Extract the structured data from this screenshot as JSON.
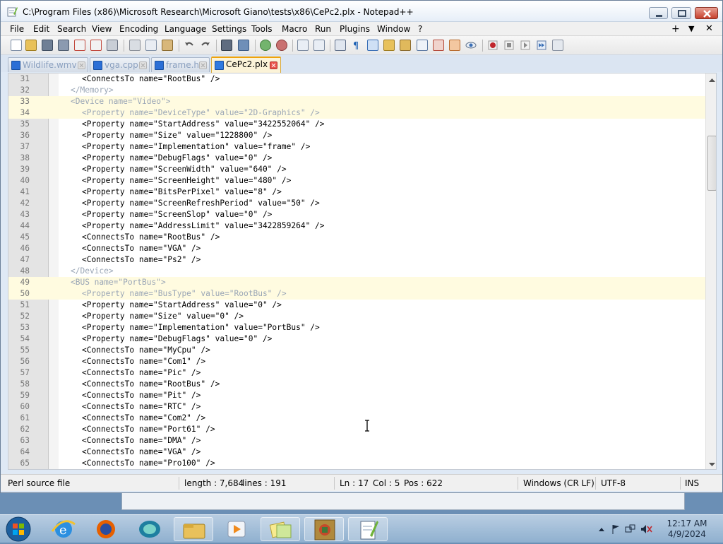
{
  "window": {
    "title": "C:\\Program Files (x86)\\Microsoft Research\\Microsoft Giano\\tests\\x86\\CePc2.plx - Notepad++"
  },
  "menubar": {
    "items": [
      "File",
      "Edit",
      "Search",
      "View",
      "Encoding",
      "Language",
      "Settings",
      "Tools",
      "Macro",
      "Run",
      "Plugins",
      "Window",
      "?"
    ],
    "right": {
      "plus": "+",
      "down": "▼",
      "close": "✕"
    }
  },
  "tabs": [
    {
      "label": "Wildlife.wmv",
      "active": false
    },
    {
      "label": "vga.cpp",
      "active": false
    },
    {
      "label": "frame.h",
      "active": false
    },
    {
      "label": "CePc2.plx",
      "active": true
    }
  ],
  "editor": {
    "lines": [
      {
        "n": "31",
        "indent": 4,
        "text": "<ConnectsTo name=\"RootBus\" />",
        "dim": false,
        "hl": false
      },
      {
        "n": "32",
        "indent": 2,
        "text": "</Memory>",
        "dim": true,
        "hl": false
      },
      {
        "n": "33",
        "indent": 2,
        "text": "<Device name=\"Video\">",
        "dim": true,
        "hl": true
      },
      {
        "n": "34",
        "indent": 4,
        "text": "<Property name=\"DeviceType\" value=\"2D-Graphics\" />",
        "dim": true,
        "hl": true
      },
      {
        "n": "35",
        "indent": 4,
        "text": "<Property name=\"StartAddress\" value=\"3422552064\" />",
        "dim": false,
        "hl": false
      },
      {
        "n": "36",
        "indent": 4,
        "text": "<Property name=\"Size\" value=\"1228800\" />",
        "dim": false,
        "hl": false
      },
      {
        "n": "37",
        "indent": 4,
        "text": "<Property name=\"Implementation\" value=\"frame\" />",
        "dim": false,
        "hl": false
      },
      {
        "n": "38",
        "indent": 4,
        "text": "<Property name=\"DebugFlags\" value=\"0\" />",
        "dim": false,
        "hl": false
      },
      {
        "n": "39",
        "indent": 4,
        "text": "<Property name=\"ScreenWidth\" value=\"640\" />",
        "dim": false,
        "hl": false
      },
      {
        "n": "40",
        "indent": 4,
        "text": "<Property name=\"ScreenHeight\" value=\"480\" />",
        "dim": false,
        "hl": false
      },
      {
        "n": "41",
        "indent": 4,
        "text": "<Property name=\"BitsPerPixel\" value=\"8\" />",
        "dim": false,
        "hl": false
      },
      {
        "n": "42",
        "indent": 4,
        "text": "<Property name=\"ScreenRefreshPeriod\" value=\"50\" />",
        "dim": false,
        "hl": false
      },
      {
        "n": "43",
        "indent": 4,
        "text": "<Property name=\"ScreenSlop\" value=\"0\" />",
        "dim": false,
        "hl": false
      },
      {
        "n": "44",
        "indent": 4,
        "text": "<Property name=\"AddressLimit\" value=\"3422859264\" />",
        "dim": false,
        "hl": false
      },
      {
        "n": "45",
        "indent": 4,
        "text": "<ConnectsTo name=\"RootBus\" />",
        "dim": false,
        "hl": false
      },
      {
        "n": "46",
        "indent": 4,
        "text": "<ConnectsTo name=\"VGA\" />",
        "dim": false,
        "hl": false
      },
      {
        "n": "47",
        "indent": 4,
        "text": "<ConnectsTo name=\"Ps2\" />",
        "dim": false,
        "hl": false
      },
      {
        "n": "48",
        "indent": 2,
        "text": "</Device>",
        "dim": true,
        "hl": false
      },
      {
        "n": "49",
        "indent": 2,
        "text": "<BUS name=\"PortBus\">",
        "dim": true,
        "hl": true
      },
      {
        "n": "50",
        "indent": 4,
        "text": "<Property name=\"BusType\" value=\"RootBus\" />",
        "dim": true,
        "hl": true
      },
      {
        "n": "51",
        "indent": 4,
        "text": "<Property name=\"StartAddress\" value=\"0\" />",
        "dim": false,
        "hl": false
      },
      {
        "n": "52",
        "indent": 4,
        "text": "<Property name=\"Size\" value=\"0\" />",
        "dim": false,
        "hl": false
      },
      {
        "n": "53",
        "indent": 4,
        "text": "<Property name=\"Implementation\" value=\"PortBus\" />",
        "dim": false,
        "hl": false
      },
      {
        "n": "54",
        "indent": 4,
        "text": "<Property name=\"DebugFlags\" value=\"0\" />",
        "dim": false,
        "hl": false
      },
      {
        "n": "55",
        "indent": 4,
        "text": "<ConnectsTo name=\"MyCpu\" />",
        "dim": false,
        "hl": false
      },
      {
        "n": "56",
        "indent": 4,
        "text": "<ConnectsTo name=\"Com1\" />",
        "dim": false,
        "hl": false
      },
      {
        "n": "57",
        "indent": 4,
        "text": "<ConnectsTo name=\"Pic\" />",
        "dim": false,
        "hl": false
      },
      {
        "n": "58",
        "indent": 4,
        "text": "<ConnectsTo name=\"RootBus\" />",
        "dim": false,
        "hl": false
      },
      {
        "n": "59",
        "indent": 4,
        "text": "<ConnectsTo name=\"Pit\" />",
        "dim": false,
        "hl": false
      },
      {
        "n": "60",
        "indent": 4,
        "text": "<ConnectsTo name=\"RTC\" />",
        "dim": false,
        "hl": false
      },
      {
        "n": "61",
        "indent": 4,
        "text": "<ConnectsTo name=\"Com2\" />",
        "dim": false,
        "hl": false
      },
      {
        "n": "62",
        "indent": 4,
        "text": "<ConnectsTo name=\"Port61\" />",
        "dim": false,
        "hl": false
      },
      {
        "n": "63",
        "indent": 4,
        "text": "<ConnectsTo name=\"DMA\" />",
        "dim": false,
        "hl": false
      },
      {
        "n": "64",
        "indent": 4,
        "text": "<ConnectsTo name=\"VGA\" />",
        "dim": false,
        "hl": false
      },
      {
        "n": "65",
        "indent": 4,
        "text": "<ConnectsTo name=\"Pro100\" />",
        "dim": false,
        "hl": false
      }
    ]
  },
  "statusbar": {
    "file_type": "Perl source file",
    "length": "length : 7,684",
    "lines": "lines : 191",
    "ln": "Ln : 17",
    "col": "Col : 5",
    "pos": "Pos : 622",
    "eol": "Windows (CR LF)",
    "encoding": "UTF-8",
    "mode": "INS"
  },
  "taskbar": {
    "time": "12:17 AM",
    "date": "4/9/2024",
    "apps": [
      "internet-explorer-icon",
      "firefox-icon",
      "chat-icon",
      "file-explorer-icon",
      "media-player-icon",
      "sticky-notes-icon",
      "game-icon",
      "notepad-plus-plus-icon"
    ]
  },
  "colors": {
    "accent": "#f0a30a",
    "taskbar": "#8fb0cf",
    "line_highlight": "#fffbe0"
  }
}
